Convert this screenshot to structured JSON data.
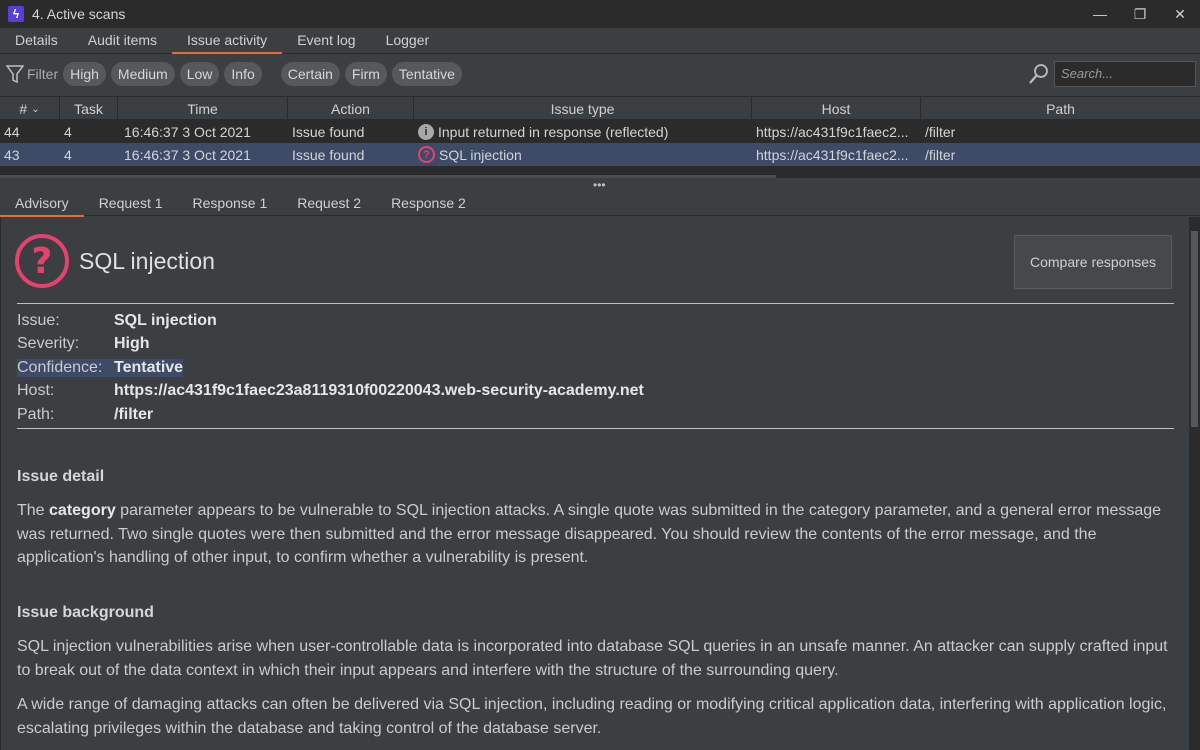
{
  "window": {
    "title": "4. Active scans",
    "controls": [
      "minimize",
      "restore",
      "close"
    ]
  },
  "top_tabs": [
    "Details",
    "Audit items",
    "Issue activity",
    "Event log",
    "Logger"
  ],
  "filter": {
    "label": "Filter",
    "severity": [
      "High",
      "Medium",
      "Low",
      "Info"
    ],
    "confidence": [
      "Certain",
      "Firm",
      "Tentative"
    ],
    "search_placeholder": "Search..."
  },
  "table": {
    "columns": [
      "#",
      "Task",
      "Time",
      "Action",
      "Issue type",
      "Host",
      "Path"
    ],
    "rows": [
      {
        "num": "44",
        "task": "4",
        "time": "16:46:37 3 Oct 2021",
        "action": "Issue found",
        "issue_type": "Input returned in response (reflected)",
        "icon": "info-icon",
        "host": "https://ac431f9c1faec2...",
        "path": "/filter"
      },
      {
        "num": "43",
        "task": "4",
        "time": "16:46:37 3 Oct 2021",
        "action": "Issue found",
        "issue_type": "SQL injection",
        "icon": "question-icon",
        "host": "https://ac431f9c1faec2...",
        "path": "/filter"
      }
    ]
  },
  "sub_tabs": [
    "Advisory",
    "Request 1",
    "Response 1",
    "Request 2",
    "Response 2"
  ],
  "advisory": {
    "title": "SQL injection",
    "compare_button": "Compare responses",
    "fields": [
      {
        "label": "Issue:",
        "value": "SQL injection"
      },
      {
        "label": "Severity:",
        "value": "High"
      },
      {
        "label": "Confidence:",
        "value": "Tentative"
      },
      {
        "label": "Host:",
        "value": "https://ac431f9c1faec23a8119310f00220043.web-security-academy.net"
      },
      {
        "label": "Path:",
        "value": "/filter"
      }
    ],
    "issue_detail_title": "Issue detail",
    "issue_detail_pre": "The ",
    "issue_detail_bold": "category",
    "issue_detail_post": " parameter appears to be vulnerable to SQL injection attacks. A single quote was submitted in the category parameter, and a general error message was returned. Two single quotes were then submitted and the error message disappeared. You should review the contents of the error message, and the application's handling of other input, to confirm whether a vulnerability is present.",
    "issue_background_title": "Issue background",
    "issue_background_p1": "SQL injection vulnerabilities arise when user-controllable data is incorporated into database SQL queries in an unsafe manner. An attacker can supply crafted input to break out of the data context in which their input appears and interfere with the structure of the surrounding query.",
    "issue_background_p2": "A wide range of damaging attacks can often be delivered via SQL injection, including reading or modifying critical application data, interfering with application logic, escalating privileges within the database and taking control of the database server."
  },
  "colors": {
    "accent_tab": "#e86a3a",
    "severity_high": "#e8416e",
    "selection": "#3d4b66"
  }
}
